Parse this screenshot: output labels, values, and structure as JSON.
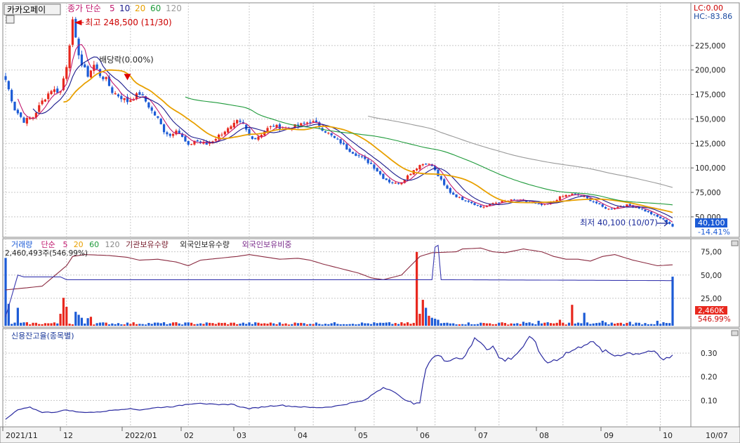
{
  "title_tab": "카카오페이",
  "price_legend": {
    "label": "종가 단순",
    "p5": "5",
    "p10": "10",
    "p20": "20",
    "p60": "60",
    "p120": "120"
  },
  "high_note": "최고 248,500 (11/30)",
  "dividend_note": "배당락(0.00%)",
  "low_note": "최저 40,100 (10/07)",
  "lc_label": "LC:0.00",
  "hc_label": "HC:-83.86",
  "last_price": "40,100",
  "last_change": "-14.41%",
  "volume_legend": {
    "label": "거래량",
    "ma": "단순",
    "p5": "5",
    "p20": "20",
    "p60": "60",
    "p120": "120",
    "inst": "기관보유수량",
    "foreign": "외국인보유수량",
    "foreign_ratio": "외국인보유비중"
  },
  "volume_info": "2,460,493주(546.99%)",
  "volume_last": "2,460K",
  "volume_pct": "546.99%",
  "credit_label": "신용잔고율(종목별)",
  "colors": {
    "up": "#e8281e",
    "down": "#1c5bd6",
    "ma5": "#c0186e",
    "ma10": "#1a1a8c",
    "ma20": "#e8a000",
    "ma60": "#1e9a3a",
    "ma120": "#9a9a9a",
    "credit": "#2a2aa0",
    "foreign_ratio": "#8a2a40",
    "grid": "#c8c8c8"
  },
  "chart_data": [
    {
      "type": "candlestick",
      "title": "카카오페이",
      "x_tick_labels": [
        "2021/11",
        "12",
        "2022/01",
        "02",
        "03",
        "04",
        "05",
        "06",
        "07",
        "08",
        "09",
        "10",
        "10/07"
      ],
      "y_ticks": [
        50000,
        75000,
        100000,
        125000,
        150000,
        175000,
        200000,
        225000
      ],
      "y_tick_labels": [
        "50,000",
        "75,000",
        "100,000",
        "125,000",
        "150,000",
        "175,000",
        "200,000",
        "225,000"
      ],
      "ylim": [
        32000,
        250000
      ],
      "close_waypoints": [
        [
          0,
          190000
        ],
        [
          3,
          160000
        ],
        [
          6,
          148000
        ],
        [
          9,
          152000
        ],
        [
          12,
          168000
        ],
        [
          15,
          180000
        ],
        [
          18,
          178000
        ],
        [
          20,
          205000
        ],
        [
          21,
          228000
        ],
        [
          22,
          248500
        ],
        [
          23,
          230000
        ],
        [
          25,
          205000
        ],
        [
          27,
          195000
        ],
        [
          29,
          205000
        ],
        [
          31,
          195000
        ],
        [
          33,
          190000
        ],
        [
          35,
          178000
        ],
        [
          38,
          172000
        ],
        [
          40,
          168000
        ],
        [
          42,
          172000
        ],
        [
          44,
          176000
        ],
        [
          46,
          168000
        ],
        [
          48,
          158000
        ],
        [
          50,
          150000
        ],
        [
          52,
          138000
        ],
        [
          54,
          133000
        ],
        [
          56,
          140000
        ],
        [
          58,
          131000
        ],
        [
          60,
          122000
        ],
        [
          62,
          128000
        ],
        [
          64,
          126000
        ],
        [
          66,
          124000
        ],
        [
          68,
          128000
        ],
        [
          70,
          133000
        ],
        [
          72,
          138000
        ],
        [
          74,
          141000
        ],
        [
          76,
          147000
        ],
        [
          78,
          144000
        ],
        [
          80,
          133000
        ],
        [
          82,
          130000
        ],
        [
          84,
          135000
        ],
        [
          86,
          140000
        ],
        [
          88,
          143000
        ],
        [
          90,
          141000
        ],
        [
          92,
          140000
        ],
        [
          94,
          142000
        ],
        [
          96,
          143000
        ],
        [
          98,
          145000
        ],
        [
          100,
          148000
        ],
        [
          102,
          145000
        ],
        [
          104,
          140000
        ],
        [
          106,
          135000
        ],
        [
          108,
          130000
        ],
        [
          110,
          126000
        ],
        [
          112,
          120000
        ],
        [
          114,
          116000
        ],
        [
          116,
          112000
        ],
        [
          118,
          108000
        ],
        [
          120,
          104000
        ],
        [
          122,
          97000
        ],
        [
          124,
          90000
        ],
        [
          126,
          86000
        ],
        [
          128,
          84000
        ],
        [
          130,
          86000
        ],
        [
          132,
          92000
        ],
        [
          134,
          98000
        ],
        [
          136,
          103000
        ],
        [
          138,
          105000
        ],
        [
          140,
          102000
        ],
        [
          142,
          92000
        ],
        [
          144,
          82000
        ],
        [
          146,
          75000
        ],
        [
          148,
          71000
        ],
        [
          150,
          68000
        ],
        [
          152,
          66000
        ],
        [
          154,
          63000
        ],
        [
          156,
          60000
        ],
        [
          158,
          61000
        ],
        [
          160,
          64000
        ],
        [
          162,
          65000
        ],
        [
          164,
          66000
        ],
        [
          166,
          67000
        ],
        [
          168,
          67000
        ],
        [
          170,
          66000
        ],
        [
          172,
          65000
        ],
        [
          174,
          63000
        ],
        [
          176,
          62000
        ],
        [
          178,
          63000
        ],
        [
          180,
          66000
        ],
        [
          182,
          70000
        ],
        [
          184,
          72000
        ],
        [
          186,
          73000
        ],
        [
          188,
          72000
        ],
        [
          190,
          70000
        ],
        [
          192,
          67000
        ],
        [
          194,
          64000
        ],
        [
          196,
          60000
        ],
        [
          198,
          58000
        ],
        [
          200,
          59000
        ],
        [
          202,
          61000
        ],
        [
          204,
          62000
        ],
        [
          206,
          61000
        ],
        [
          208,
          59000
        ],
        [
          210,
          56000
        ],
        [
          212,
          53000
        ],
        [
          214,
          50000
        ],
        [
          216,
          47000
        ],
        [
          218,
          43000
        ],
        [
          219,
          40100
        ]
      ],
      "candles": 220,
      "ma_periods": [
        5,
        10,
        20,
        60,
        120
      ],
      "high": {
        "value": 248500,
        "date": "11/30"
      },
      "low": {
        "value": 40100,
        "date": "10/07"
      },
      "last_close": 40100,
      "change_pct": -14.41
    },
    {
      "type": "bar",
      "title": "거래량",
      "y_ticks_right": [
        25,
        50,
        75
      ],
      "y_tick_labels": [
        "25,00",
        "50,00",
        "75,00"
      ],
      "volume_spikes": [
        [
          0,
          3400000
        ],
        [
          1,
          1100000
        ],
        [
          4,
          900000
        ],
        [
          18,
          600000
        ],
        [
          19,
          1400000
        ],
        [
          20,
          950000
        ],
        [
          23,
          700000
        ],
        [
          24,
          550000
        ],
        [
          25,
          400000
        ],
        [
          27,
          380000
        ],
        [
          28,
          450000
        ],
        [
          135,
          3700000
        ],
        [
          136,
          600000
        ],
        [
          137,
          1300000
        ],
        [
          138,
          900000
        ],
        [
          139,
          500000
        ],
        [
          140,
          400000
        ],
        [
          141,
          350000
        ],
        [
          142,
          300000
        ],
        [
          170,
          200000
        ],
        [
          175,
          250000
        ],
        [
          182,
          300000
        ],
        [
          186,
          1050000
        ],
        [
          190,
          650000
        ],
        [
          196,
          250000
        ],
        [
          205,
          200000
        ],
        [
          214,
          250000
        ],
        [
          219,
          2460493
        ]
      ],
      "last_volume": 2460493,
      "last_volume_pct": 546.99
    },
    {
      "type": "line",
      "title": "신용잔고율(종목별)",
      "y_ticks": [
        0.1,
        0.2,
        0.3
      ],
      "y_tick_labels": [
        "0.10",
        "0.20",
        "0.30"
      ],
      "ylim": [
        0.0,
        0.38
      ],
      "waypoints": [
        [
          0,
          0.02
        ],
        [
          4,
          0.06
        ],
        [
          8,
          0.07
        ],
        [
          12,
          0.05
        ],
        [
          16,
          0.05
        ],
        [
          20,
          0.06
        ],
        [
          24,
          0.05
        ],
        [
          30,
          0.05
        ],
        [
          36,
          0.06
        ],
        [
          40,
          0.065
        ],
        [
          44,
          0.06
        ],
        [
          50,
          0.07
        ],
        [
          56,
          0.075
        ],
        [
          60,
          0.085
        ],
        [
          64,
          0.09
        ],
        [
          66,
          0.085
        ],
        [
          70,
          0.08
        ],
        [
          74,
          0.085
        ],
        [
          78,
          0.07
        ],
        [
          80,
          0.065
        ],
        [
          86,
          0.075
        ],
        [
          90,
          0.08
        ],
        [
          94,
          0.075
        ],
        [
          100,
          0.07
        ],
        [
          104,
          0.07
        ],
        [
          108,
          0.075
        ],
        [
          112,
          0.085
        ],
        [
          116,
          0.095
        ],
        [
          118,
          0.1
        ],
        [
          122,
          0.14
        ],
        [
          124,
          0.155
        ],
        [
          126,
          0.15
        ],
        [
          128,
          0.13
        ],
        [
          130,
          0.11
        ],
        [
          132,
          0.1
        ],
        [
          134,
          0.085
        ],
        [
          136,
          0.09
        ],
        [
          138,
          0.24
        ],
        [
          140,
          0.28
        ],
        [
          142,
          0.29
        ],
        [
          144,
          0.27
        ],
        [
          148,
          0.28
        ],
        [
          150,
          0.28
        ],
        [
          152,
          0.31
        ],
        [
          154,
          0.36
        ],
        [
          156,
          0.35
        ],
        [
          158,
          0.32
        ],
        [
          160,
          0.33
        ],
        [
          162,
          0.28
        ],
        [
          164,
          0.27
        ],
        [
          166,
          0.28
        ],
        [
          168,
          0.3
        ],
        [
          170,
          0.33
        ],
        [
          172,
          0.36
        ],
        [
          174,
          0.35
        ],
        [
          176,
          0.28
        ],
        [
          178,
          0.26
        ],
        [
          180,
          0.27
        ],
        [
          182,
          0.28
        ],
        [
          184,
          0.3
        ],
        [
          186,
          0.31
        ],
        [
          188,
          0.32
        ],
        [
          190,
          0.34
        ],
        [
          192,
          0.35
        ],
        [
          194,
          0.33
        ],
        [
          196,
          0.31
        ],
        [
          198,
          0.3
        ],
        [
          200,
          0.29
        ],
        [
          204,
          0.3
        ],
        [
          208,
          0.3
        ],
        [
          212,
          0.31
        ],
        [
          216,
          0.27
        ],
        [
          219,
          0.29
        ]
      ]
    }
  ]
}
